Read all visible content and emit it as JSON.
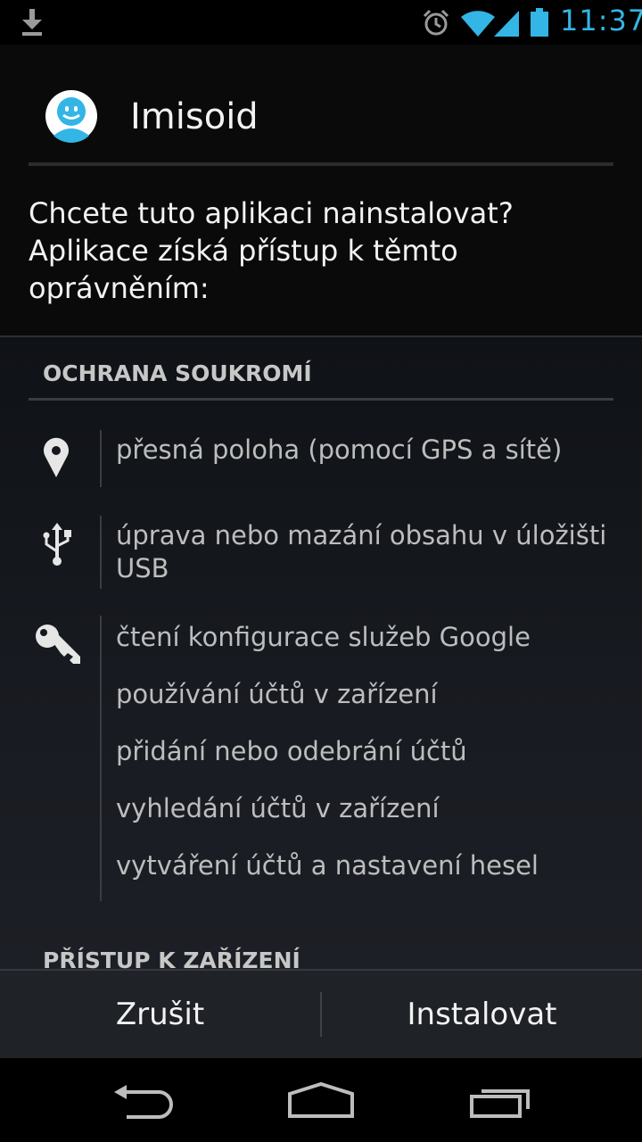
{
  "status_bar": {
    "time": "11:37",
    "icons": [
      "download-icon",
      "alarm-icon",
      "wifi-icon",
      "signal-icon",
      "battery-icon"
    ]
  },
  "app": {
    "name": "Imisoid",
    "prompt": "Chcete tuto aplikaci nainstalovat? Aplikace získá přístup k těmto oprávněním:"
  },
  "sections": {
    "privacy": {
      "title": "OCHRANA SOUKROMÍ",
      "location": "přesná poloha (pomocí GPS a sítě)",
      "storage": "úprava nebo mazání obsahu v úložišti USB",
      "accounts": [
        "čtení konfigurace služeb Google",
        "používání účtů v zařízení",
        "přidání nebo odebrání účtů",
        "vyhledání účtů v zařízení",
        "vytváření účtů a nastavení hesel"
      ]
    },
    "device": {
      "title": "PŘÍSTUP K ZAŘÍZENÍ"
    }
  },
  "buttons": {
    "cancel": "Zrušit",
    "install": "Instalovat"
  },
  "nav_icons": [
    "back-icon",
    "home-icon",
    "recents-icon"
  ],
  "colors": {
    "accent": "#33b5e5",
    "app_icon": "#33b5e5"
  }
}
